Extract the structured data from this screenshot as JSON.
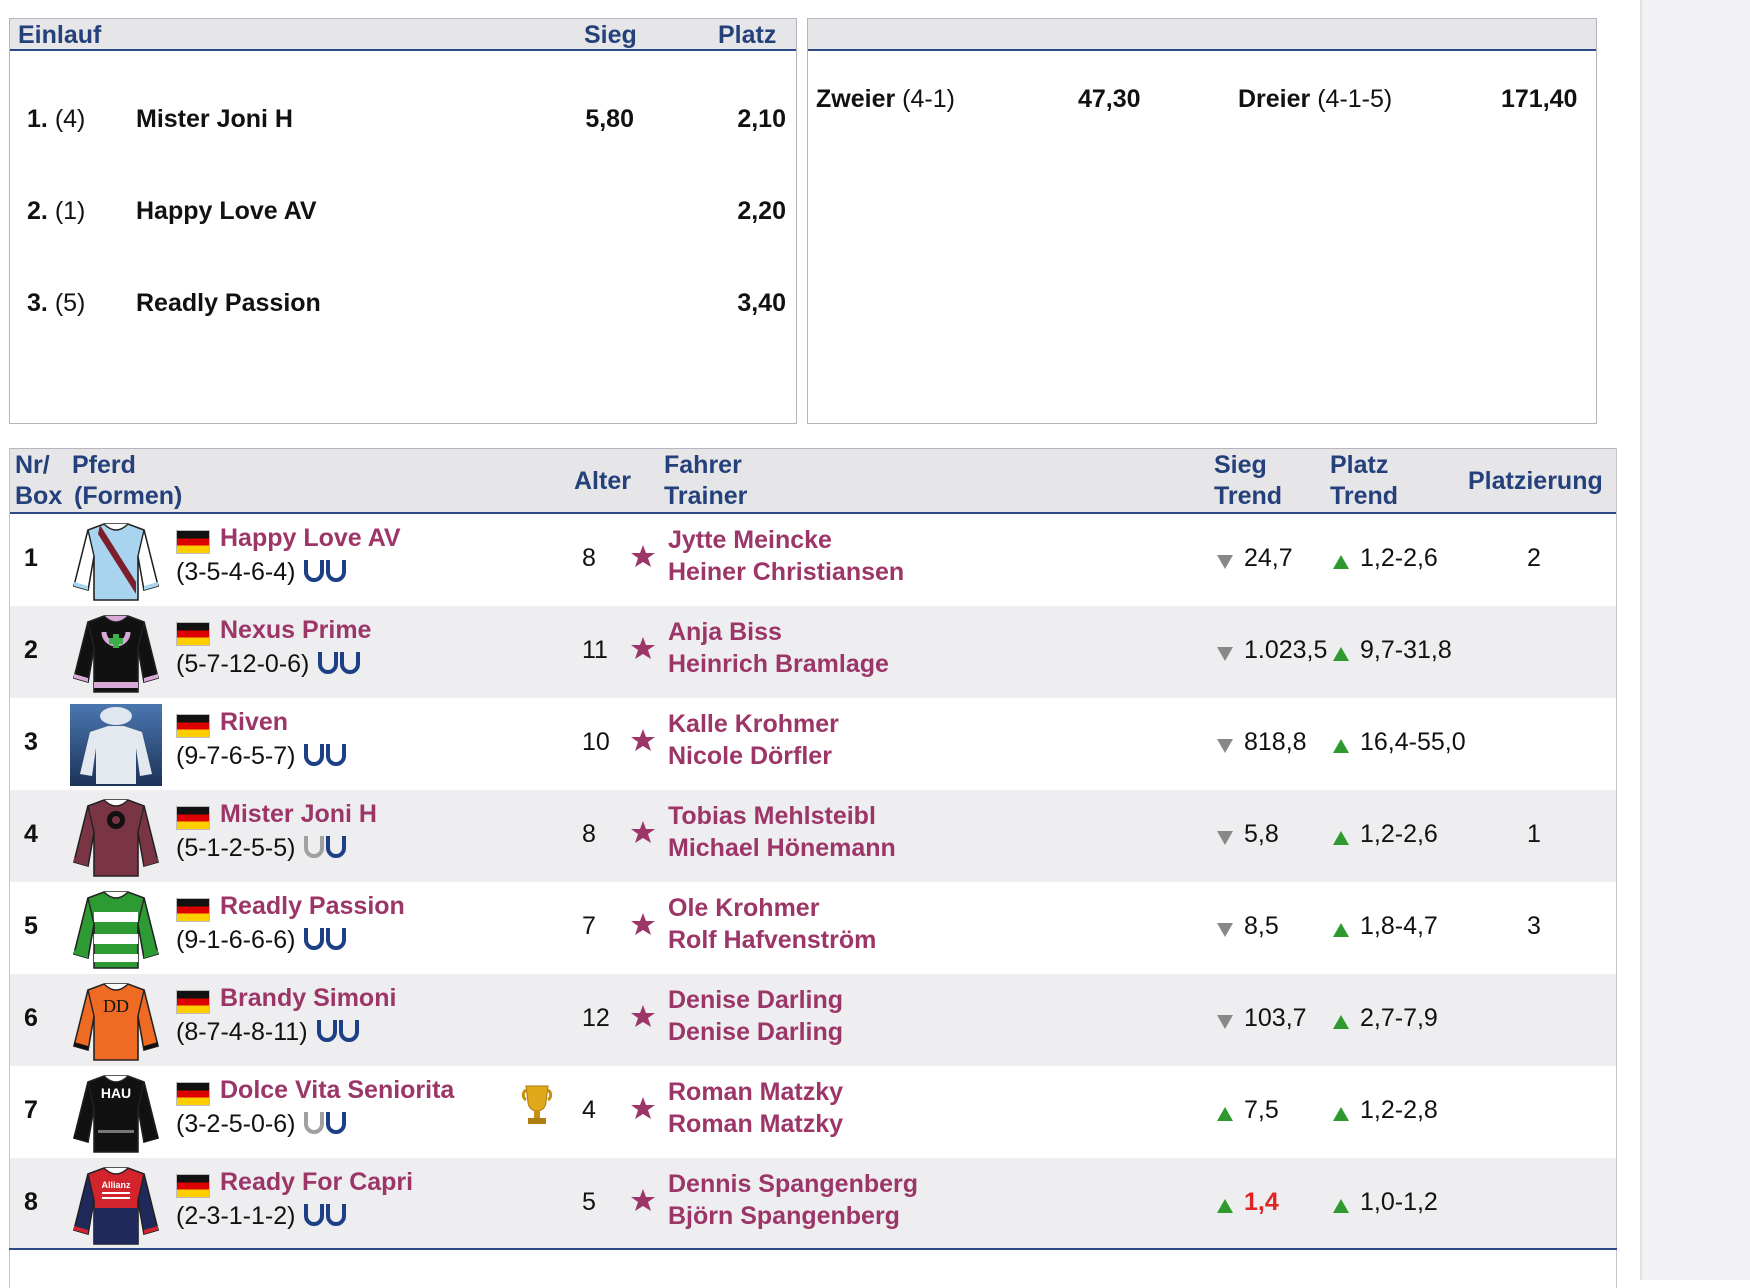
{
  "result_box": {
    "headers": {
      "einlauf": "Einlauf",
      "sieg": "Sieg",
      "platz": "Platz"
    },
    "rows": [
      {
        "place": "1.",
        "box": "(4)",
        "horse": "Mister Joni H",
        "sieg": "5,80",
        "platz": "2,10"
      },
      {
        "place": "2.",
        "box": "(1)",
        "horse": "Happy Love AV",
        "sieg": "",
        "platz": "2,20"
      },
      {
        "place": "3.",
        "box": "(5)",
        "horse": "Readly Passion",
        "sieg": "",
        "platz": "3,40"
      }
    ]
  },
  "bets_box": {
    "zweier_label": "Zweier",
    "zweier_combo": "(4-1)",
    "zweier_value": "47,30",
    "dreier_label": "Dreier",
    "dreier_combo": "(4-1-5)",
    "dreier_value": "171,40"
  },
  "table": {
    "headers": {
      "nr": "Nr/",
      "box": "Box",
      "pferd": "Pferd",
      "formen": "(Formen)",
      "alter": "Alter",
      "fahrer": "Fahrer",
      "trainer": "Trainer",
      "sieg": "Sieg",
      "sieg_trend": "Trend",
      "platz": "Platz",
      "platz_trend": "Trend",
      "platzierung": "Platzierung"
    },
    "rows": [
      {
        "nr": "1",
        "horse": "Happy Love AV",
        "forms": "(3-5-4-6-4)",
        "shoes": [
          "blue",
          "blue"
        ],
        "age": "8",
        "driver": "Jytte Meincke",
        "trainer": "Heiner Christiansen",
        "sieg_dir": "down",
        "sieg": "24,7",
        "platz_dir": "up",
        "platz": "1,2-2,6",
        "placing": "2",
        "silk": "light-blue-sash"
      },
      {
        "nr": "2",
        "horse": "Nexus Prime",
        "forms": "(5-7-12-0-6)",
        "shoes": [
          "blue",
          "blue"
        ],
        "age": "11",
        "driver": "Anja Biss",
        "trainer": "Heinrich Bramlage",
        "sieg_dir": "down",
        "sieg": "1.023,5",
        "platz_dir": "up",
        "platz": "9,7-31,8",
        "placing": "",
        "silk": "black-horseshoe"
      },
      {
        "nr": "3",
        "horse": "Riven",
        "forms": "(9-7-6-5-7)",
        "shoes": [
          "blue",
          "blue"
        ],
        "age": "10",
        "driver": "Kalle Krohmer",
        "trainer": "Nicole Dörfler",
        "sieg_dir": "down",
        "sieg": "818,8",
        "platz_dir": "up",
        "platz": "16,4-55,0",
        "placing": "",
        "silk": "placeholder"
      },
      {
        "nr": "4",
        "horse": "Mister Joni H",
        "forms": "(5-1-2-5-5)",
        "shoes": [
          "grey",
          "blue"
        ],
        "age": "8",
        "driver": "Tobias Mehlsteibl",
        "trainer": "Michael Hönemann",
        "sieg_dir": "down",
        "sieg": "5,8",
        "platz_dir": "up",
        "platz": "1,2-2,6",
        "placing": "1",
        "silk": "maroon-emblem"
      },
      {
        "nr": "5",
        "horse": "Readly Passion",
        "forms": "(9-1-6-6-6)",
        "shoes": [
          "blue",
          "blue"
        ],
        "age": "7",
        "driver": "Ole Krohmer",
        "trainer": "Rolf Hafvenström",
        "sieg_dir": "down",
        "sieg": "8,5",
        "platz_dir": "up",
        "platz": "1,8-4,7",
        "placing": "3",
        "silk": "green-hoops"
      },
      {
        "nr": "6",
        "horse": "Brandy Simoni",
        "forms": "(8-7-4-8-11)",
        "shoes": [
          "blue",
          "blue"
        ],
        "age": "12",
        "driver": "Denise Darling",
        "trainer": "Denise Darling",
        "sieg_dir": "down",
        "sieg": "103,7",
        "platz_dir": "up",
        "platz": "2,7-7,9",
        "placing": "",
        "silk": "orange-dd"
      },
      {
        "nr": "7",
        "horse": "Dolce Vita Seniorita",
        "forms": "(3-2-5-0-6)",
        "shoes": [
          "grey",
          "blue"
        ],
        "age": "4",
        "driver": "Roman Matzky",
        "trainer": "Roman Matzky",
        "sieg_dir": "up",
        "sieg": "7,5",
        "platz_dir": "up",
        "platz": "1,2-2,8",
        "placing": "",
        "silk": "black-hau",
        "trophy": true
      },
      {
        "nr": "8",
        "horse": "Ready For Capri",
        "forms": "(2-3-1-1-2)",
        "shoes": [
          "blue",
          "blue"
        ],
        "age": "5",
        "driver": "Dennis Spangenberg",
        "trainer": "Björn Spangenberg",
        "sieg_dir": "up",
        "sieg": "1,4",
        "sieg_highlight": true,
        "platz_dir": "up",
        "platz": "1,0-1,2",
        "placing": "",
        "silk": "allianz"
      }
    ]
  },
  "silk_texts": {
    "hau": "HAU",
    "dd": "DD",
    "allianz": "Allianz"
  },
  "colors": {
    "header_text": "#25417c",
    "link": "#9c3568",
    "trend_up": "#2e9a2e",
    "trend_down": "#888888",
    "highlight": "#e02323"
  }
}
